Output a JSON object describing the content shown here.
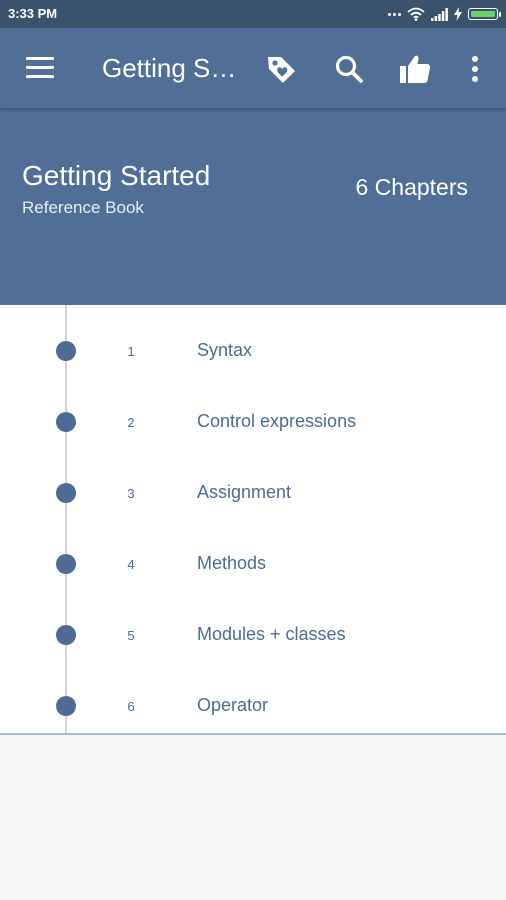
{
  "status_bar": {
    "time": "3:33 PM",
    "icons": [
      "more-dots-icon",
      "wifi-icon",
      "signal-icon",
      "charging-bolt-icon",
      "battery-icon"
    ],
    "battery_color": "#6cd36a"
  },
  "app_bar": {
    "title": "Getting Started",
    "icons": [
      "menu-icon",
      "tag-icon",
      "search-icon",
      "thumbs-up-icon",
      "overflow-menu-icon"
    ]
  },
  "header": {
    "title": "Getting Started",
    "subtitle": "Reference Book",
    "chapters_count": "6 Chapters"
  },
  "chapters": [
    {
      "number": "1",
      "name": "Syntax"
    },
    {
      "number": "2",
      "name": "Control expressions"
    },
    {
      "number": "3",
      "name": "Assignment"
    },
    {
      "number": "4",
      "name": "Methods"
    },
    {
      "number": "5",
      "name": "Modules + classes"
    },
    {
      "number": "6",
      "name": "Operator"
    }
  ],
  "colors": {
    "primary": "#516f96",
    "status_bar": "#3b526d",
    "accent_text": "#4d6b93",
    "background": "#f7f7f7"
  }
}
